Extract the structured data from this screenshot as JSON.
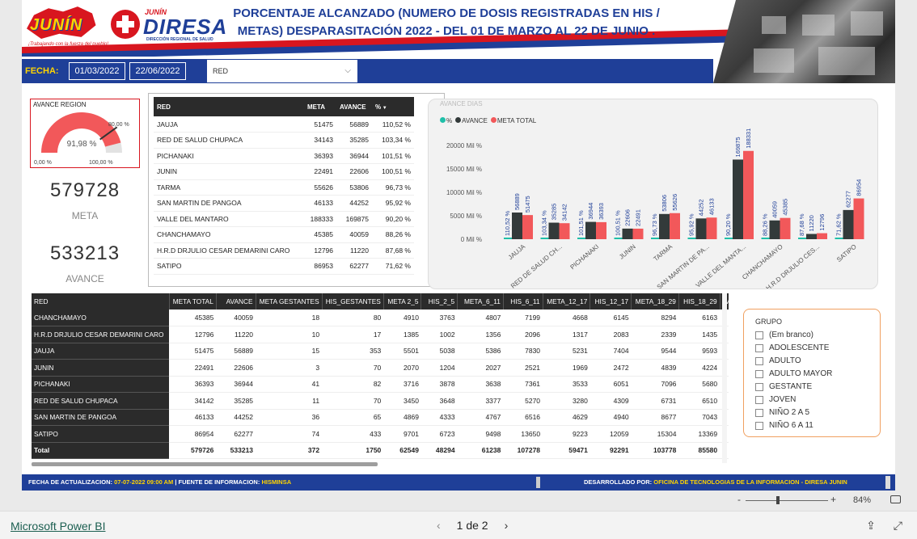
{
  "header": {
    "title_line1": "PORCENTAJE ALCANZADO (NUMERO DE DOSIS REGISTRADAS EN HIS /",
    "title_line2": "METAS) DESPARASITACIÓN 2022 - DEL 01 DE MARZO AL 22 DE JUNIO .",
    "logo_junin_text": "JUNÍN",
    "logo_junin_tagline": "¡Trabajando con la fuerza del pueblo!",
    "logo_diresa_small": "JUNÍN",
    "logo_diresa_big": "DIRESA",
    "logo_diresa_sub": "DIRECCIÓN REGIONAL DE SALUD"
  },
  "filters": {
    "fecha_label": "FECHA:",
    "date_from": "01/03/2022",
    "date_to": "22/06/2022",
    "red_dropdown": "RED"
  },
  "kpi": {
    "gauge_title": "AVANCE REGION",
    "gauge_value": "91,98 %",
    "gauge_fraction": 0.9198,
    "gauge_target": "80,00 %",
    "gauge_min": "0,00 %",
    "gauge_max": "100,00 %",
    "meta_value": "579728",
    "meta_label": "META",
    "avance_value": "533213",
    "avance_label": "AVANCE"
  },
  "red_table": {
    "headers": [
      "RED",
      "META",
      "AVANCE",
      "%"
    ],
    "rows": [
      [
        "JAUJA",
        "51475",
        "56889",
        "110,52 %"
      ],
      [
        "RED DE SALUD CHUPACA",
        "34143",
        "35285",
        "103,34 %"
      ],
      [
        "PICHANAKI",
        "36393",
        "36944",
        "101,51 %"
      ],
      [
        "JUNIN",
        "22491",
        "22606",
        "100,51 %"
      ],
      [
        "TARMA",
        "55626",
        "53806",
        "96,73 %"
      ],
      [
        "SAN MARTIN DE PANGOA",
        "46133",
        "44252",
        "95,92 %"
      ],
      [
        "VALLE DEL MANTARO",
        "188333",
        "169875",
        "90,20 %"
      ],
      [
        "CHANCHAMAYO",
        "45385",
        "40059",
        "88,26 %"
      ],
      [
        "H.R.D DRJULIO CESAR DEMARINI CARO",
        "12796",
        "11220",
        "87,68 %"
      ],
      [
        "SATIPO",
        "86953",
        "62277",
        "71,62 %"
      ]
    ]
  },
  "chart_card": {
    "title": "AVANCE DIAS",
    "legend": [
      "%",
      "AVANCE",
      "META TOTAL"
    ]
  },
  "chart_data": {
    "type": "bar",
    "categories": [
      "JAUJA",
      "RED DE SALUD CH...",
      "PICHANAKI",
      "JUNIN",
      "TARMA",
      "SAN MARTIN DE PA...",
      "VALLE DEL MANTA...",
      "CHANCHAMAYO",
      "H.R.D DRJULIO CES...",
      "SATIPO"
    ],
    "series": [
      {
        "name": "%",
        "values": [
          110.52,
          103.34,
          101.51,
          100.51,
          96.73,
          95.92,
          90.2,
          88.26,
          87.68,
          71.62
        ],
        "labels": [
          "110,52 %",
          "103,34 %",
          "101,51 %",
          "100,51 %",
          "96,73 %",
          "95,92 %",
          "90,20 %",
          "88,26 %",
          "87,68 %",
          "71,62 %"
        ],
        "color": "#1fbfa8"
      },
      {
        "name": "AVANCE",
        "values": [
          56889,
          35285,
          36944,
          22606,
          53806,
          44252,
          169875,
          40059,
          11220,
          62277
        ],
        "color": "#333a3a"
      },
      {
        "name": "META TOTAL",
        "values": [
          51475,
          34142,
          36393,
          22491,
          55626,
          46133,
          188331,
          45385,
          12796,
          86954
        ],
        "color": "#f2585a"
      }
    ],
    "yticks": [
      "0 Mil %",
      "5000 Mil %",
      "10000 Mil %",
      "15000 Mil %",
      "20000 Mil %"
    ],
    "ylim": [
      0,
      20000
    ]
  },
  "detail_table": {
    "headers": [
      "RED",
      "META TOTAL",
      "AVANCE",
      "META GESTANTES",
      "HIS_GESTANTES",
      "META 2_5",
      "HIS_2_5",
      "META_6_11",
      "HIS_6_11",
      "META_12_17",
      "HIS_12_17",
      "META_18_29",
      "HIS_18_29",
      "M"
    ],
    "rows": [
      [
        "CHANCHAMAYO",
        "45385",
        "40059",
        "18",
        "80",
        "4910",
        "3763",
        "4807",
        "7199",
        "4668",
        "6145",
        "8294",
        "6163",
        ""
      ],
      [
        "H.R.D DRJULIO CESAR DEMARINI CARO",
        "12796",
        "11220",
        "10",
        "17",
        "1385",
        "1002",
        "1356",
        "2096",
        "1317",
        "2083",
        "2339",
        "1435",
        ""
      ],
      [
        "JAUJA",
        "51475",
        "56889",
        "15",
        "353",
        "5501",
        "5038",
        "5386",
        "7830",
        "5231",
        "7404",
        "9544",
        "9593",
        ""
      ],
      [
        "JUNIN",
        "22491",
        "22606",
        "3",
        "70",
        "2070",
        "1204",
        "2027",
        "2521",
        "1969",
        "2472",
        "4839",
        "4224",
        ""
      ],
      [
        "PICHANAKI",
        "36393",
        "36944",
        "41",
        "82",
        "3716",
        "3878",
        "3638",
        "7361",
        "3533",
        "6051",
        "7096",
        "5680",
        ""
      ],
      [
        "RED DE SALUD CHUPACA",
        "34142",
        "35285",
        "11",
        "70",
        "3450",
        "3648",
        "3377",
        "5270",
        "3280",
        "4309",
        "6731",
        "6510",
        ""
      ],
      [
        "SAN MARTIN DE PANGOA",
        "46133",
        "44252",
        "36",
        "65",
        "4869",
        "4333",
        "4767",
        "6516",
        "4629",
        "4940",
        "8677",
        "7043",
        ""
      ],
      [
        "SATIPO",
        "86954",
        "62277",
        "74",
        "433",
        "9701",
        "6723",
        "9498",
        "13650",
        "9223",
        "12059",
        "15304",
        "13369",
        ""
      ]
    ],
    "total": [
      "Total",
      "579726",
      "533213",
      "372",
      "1750",
      "62549",
      "48294",
      "61238",
      "107278",
      "59471",
      "92291",
      "103778",
      "85580",
      ""
    ]
  },
  "grupo_filter": {
    "title": "GRUPO",
    "items": [
      "(Em branco)",
      "ADOLESCENTE",
      "ADULTO",
      "ADULTO MAYOR",
      "GESTANTE",
      "JOVEN",
      "NIÑO 2 A 5",
      "NIÑO 6 A 11"
    ]
  },
  "footer": {
    "update_label": "FECHA DE ACTUALIZACION:",
    "update_value": "07-07-2022   09:00 AM",
    "source_label": "| FUENTE DE INFORMACION:",
    "source_value": "HISMINSA",
    "dev_label": "DESARROLLADO POR:",
    "dev_value": "OFICINA DE TECNOLOGIAS DE LA INFORMACION  - DIRESA JUNIN"
  },
  "zoom": {
    "minus": "-",
    "plus": "+",
    "level": "84%"
  },
  "powerbi": {
    "link": "Microsoft Power BI",
    "page": "1 de 2"
  }
}
